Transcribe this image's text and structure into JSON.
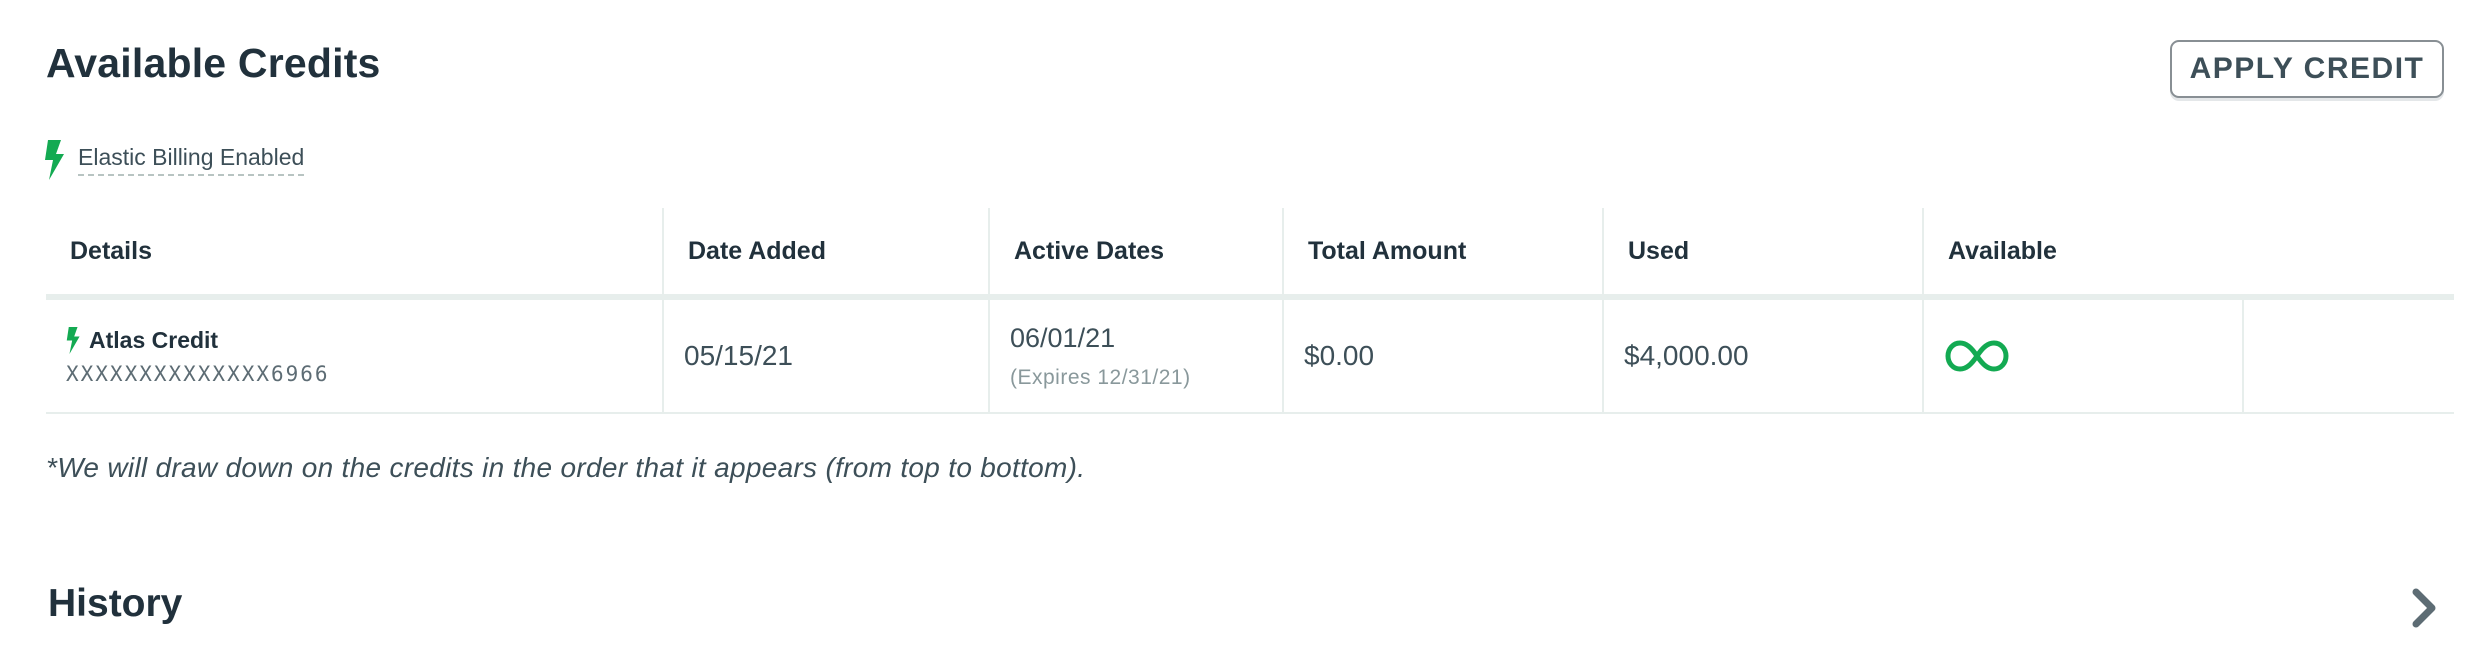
{
  "credits": {
    "title": "Available Credits",
    "apply_button": "APPLY CREDIT",
    "elastic_billing": {
      "label": "Elastic Billing Enabled",
      "icon": "lightning-bolt-icon"
    },
    "table": {
      "columns": [
        "Details",
        "Date Added",
        "Active Dates",
        "Total Amount",
        "Used",
        "Available"
      ],
      "rows": [
        {
          "name": "Atlas Credit",
          "id": "XXXXXXXXXXXXXX6966",
          "date_added": "05/15/21",
          "active_start": "06/01/21",
          "expires": "(Expires 12/31/21)",
          "total_amount": "$0.00",
          "used": "$4,000.00",
          "available_icon": "infinity-icon"
        }
      ]
    },
    "note": "*We will draw down on the credits in the order that it appears (from top to bottom)."
  },
  "history": {
    "title": "History",
    "chevron_icon": "chevron-right-icon"
  },
  "colors": {
    "accent_green": "#13aa52",
    "text_dark": "#21313c",
    "border_light": "#e7eeec"
  }
}
